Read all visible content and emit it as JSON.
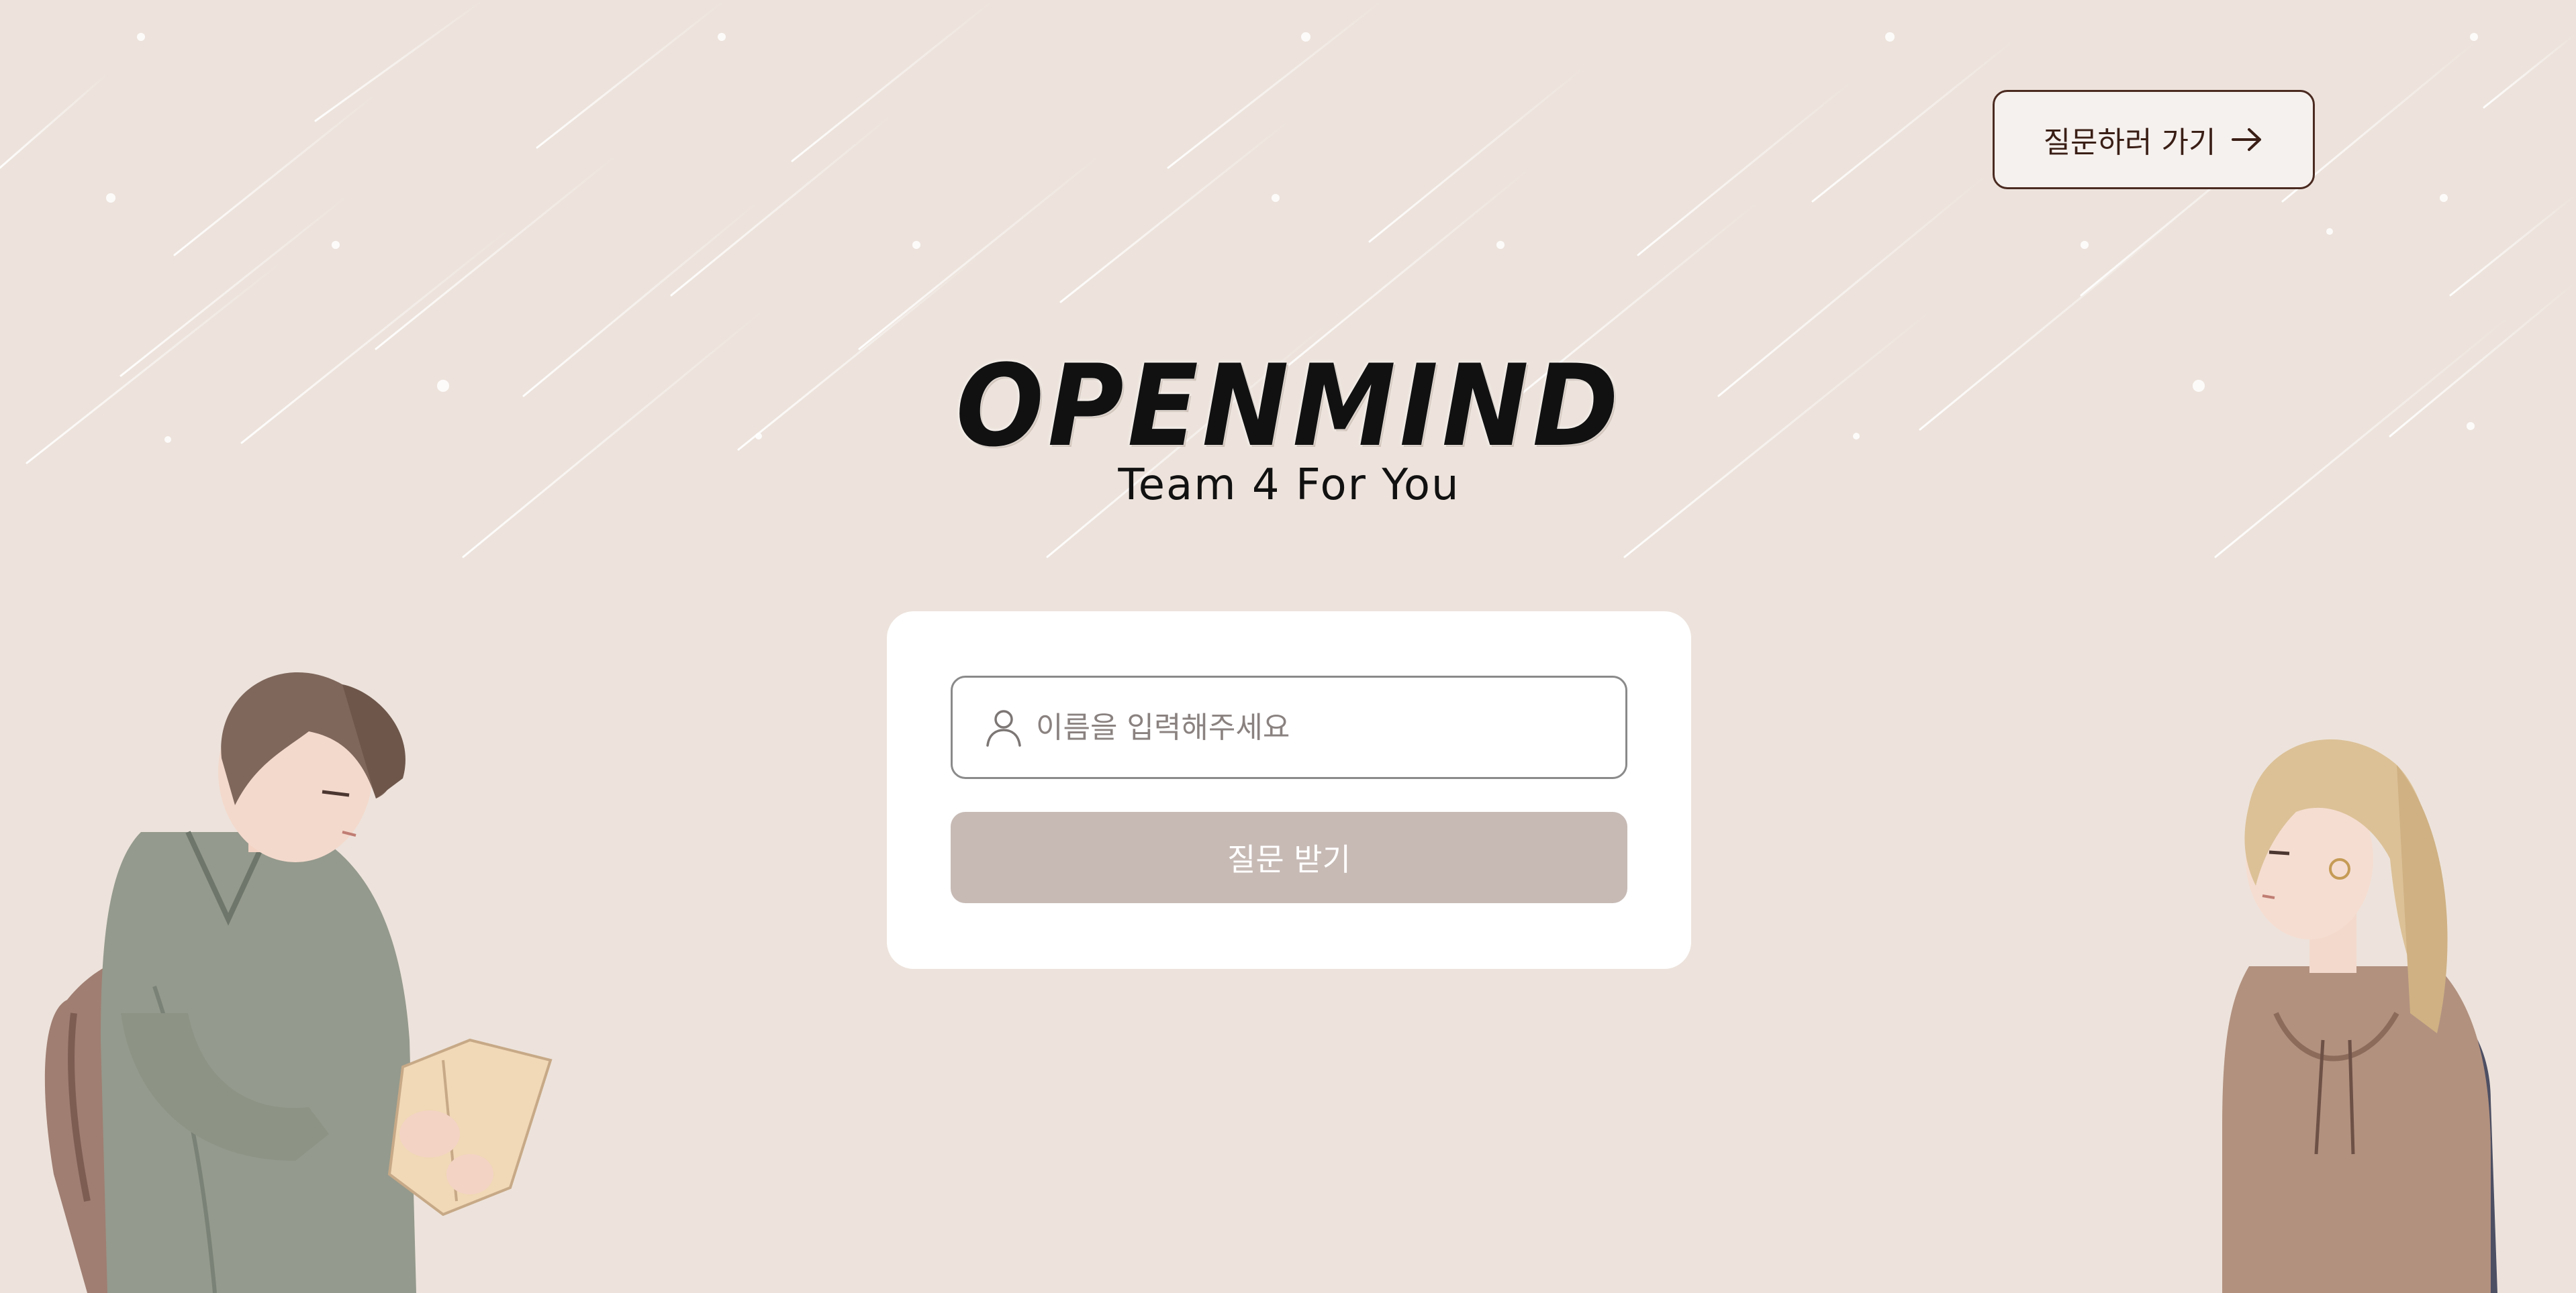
{
  "header": {
    "cta_label": "질문하러 가기",
    "cta_icon": "arrow-right-icon"
  },
  "logo": {
    "title": "OPENMIND",
    "subtitle": "Team 4 For You"
  },
  "form": {
    "name_placeholder": "이름을 입력해주세요",
    "name_value": "",
    "name_icon": "user-icon",
    "submit_label": "질문 받기"
  },
  "colors": {
    "background": "#ede3dc",
    "card": "#ffffff",
    "button_disabled": "#c7bab5",
    "cta_border": "#4a2a20",
    "text_dark": "#111111"
  },
  "illustrations": [
    "boy-reading-book",
    "girl-with-backpack"
  ]
}
